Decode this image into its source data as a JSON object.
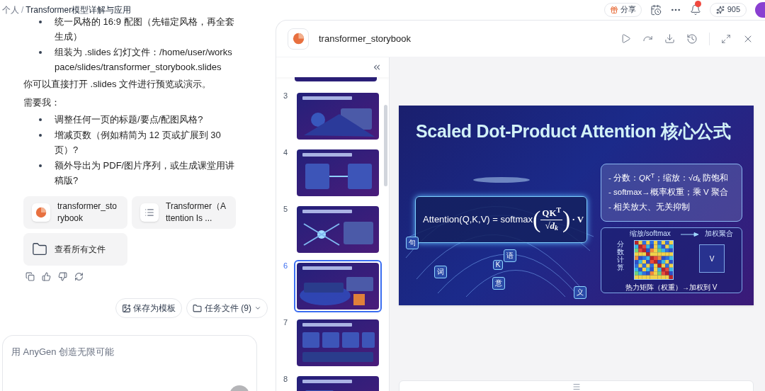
{
  "breadcrumb": {
    "parts": [
      "个人",
      "Transformer模型详解与应用"
    ],
    "separator": "/"
  },
  "topbar": {
    "share": "分享",
    "credits": "905",
    "notification": true
  },
  "chat": {
    "blocks": [
      {
        "kind": "bullet",
        "text": "统一风格的 16:9 配图（先锚定风格，再全套生成）"
      },
      {
        "kind": "bullet",
        "text": "组装为 .slides 幻灯文件：/home/user/workspace/slides/transformer_storybook.slides"
      },
      {
        "kind": "paragraph",
        "text": "你可以直接打开 .slides 文件进行预览或演示。"
      },
      {
        "kind": "paragraph",
        "text": "需要我："
      },
      {
        "kind": "bullet",
        "text": "调整任何一页的标题/要点/配图风格?"
      },
      {
        "kind": "bullet",
        "text": "增减页数（例如精简为 12 页或扩展到 30 页）?"
      },
      {
        "kind": "bullet",
        "text": "额外导出为 PDF/图片序列，或生成课堂用讲稿版?"
      }
    ],
    "files": [
      {
        "kind": "slides",
        "name": "transformer_storybook"
      },
      {
        "kind": "doc",
        "name": "Transformer（Attention Is ..."
      },
      {
        "kind": "folder",
        "name": "查看所有文件"
      }
    ],
    "save_template": "保存为模板",
    "task_files": "任务文件 (9)",
    "input": {
      "placeholder": "用 AnyGen 创造无限可能"
    }
  },
  "viewer": {
    "title": "transformer_storybook",
    "thumbnails": [
      {
        "number": "3",
        "selected": false
      },
      {
        "number": "4",
        "selected": false
      },
      {
        "number": "5",
        "selected": false
      },
      {
        "number": "6",
        "selected": true
      },
      {
        "number": "7",
        "selected": false
      },
      {
        "number": "8",
        "selected": false
      }
    ],
    "slide": {
      "title": "Scaled Dot-Product Attention 核心公式",
      "formula": {
        "lhs": "Attention(Q,K,V) = softmax",
        "left_paren": "(",
        "numerator": "QK$^{T}$",
        "denominator": "√d$_{k}$",
        "right_paren": ")",
        "rhs": "· V"
      },
      "points": [
        "- 分数：*QK*$^{T}$；缩放：√*d*$_{k}$ 防饱和",
        "- softmax→概率权重；乘 V 聚合",
        "- 相关放大、无关抑制"
      ],
      "heatmap": {
        "top_left": "缩放/softmax",
        "top_right": "加权聚合",
        "side": "分数计算",
        "output": "V",
        "caption": "热力矩阵（权重）→加权到 V"
      },
      "tokens": [
        "句",
        "语",
        "词",
        "意",
        "义",
        "K"
      ]
    }
  }
}
